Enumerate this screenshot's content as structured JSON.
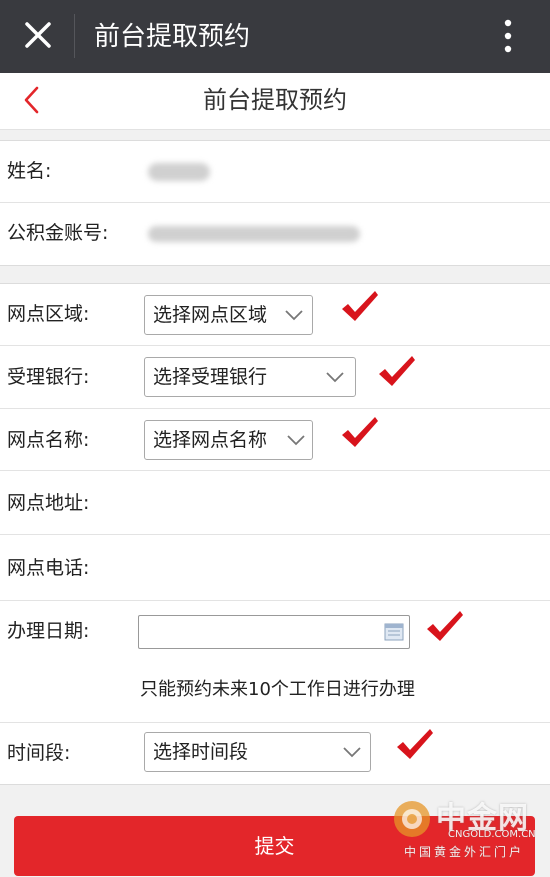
{
  "app_bar": {
    "title": "前台提取预约"
  },
  "nav": {
    "title": "前台提取预约"
  },
  "account": {
    "name_label": "姓名:",
    "account_label": "公积金账号:"
  },
  "form": {
    "area_label": "网点区域:",
    "area_select": "选择网点区域",
    "bank_label": "受理银行:",
    "bank_select": "选择受理银行",
    "branch_label": "网点名称:",
    "branch_select": "选择网点名称",
    "address_label": "网点地址:",
    "phone_label": "网点电话:",
    "date_label": "办理日期:",
    "date_value": "",
    "date_hint": "只能预约未来10个工作日进行办理",
    "time_label": "时间段:",
    "time_select": "选择时间段"
  },
  "submit_label": "提交",
  "watermark": {
    "name": "中金网",
    "domain": "CNGOLD.COM.CN",
    "slogan": "中国黄金外汇门户"
  },
  "colors": {
    "accent": "#e3262a",
    "topbar": "#393a3f",
    "check": "#d8141c"
  }
}
